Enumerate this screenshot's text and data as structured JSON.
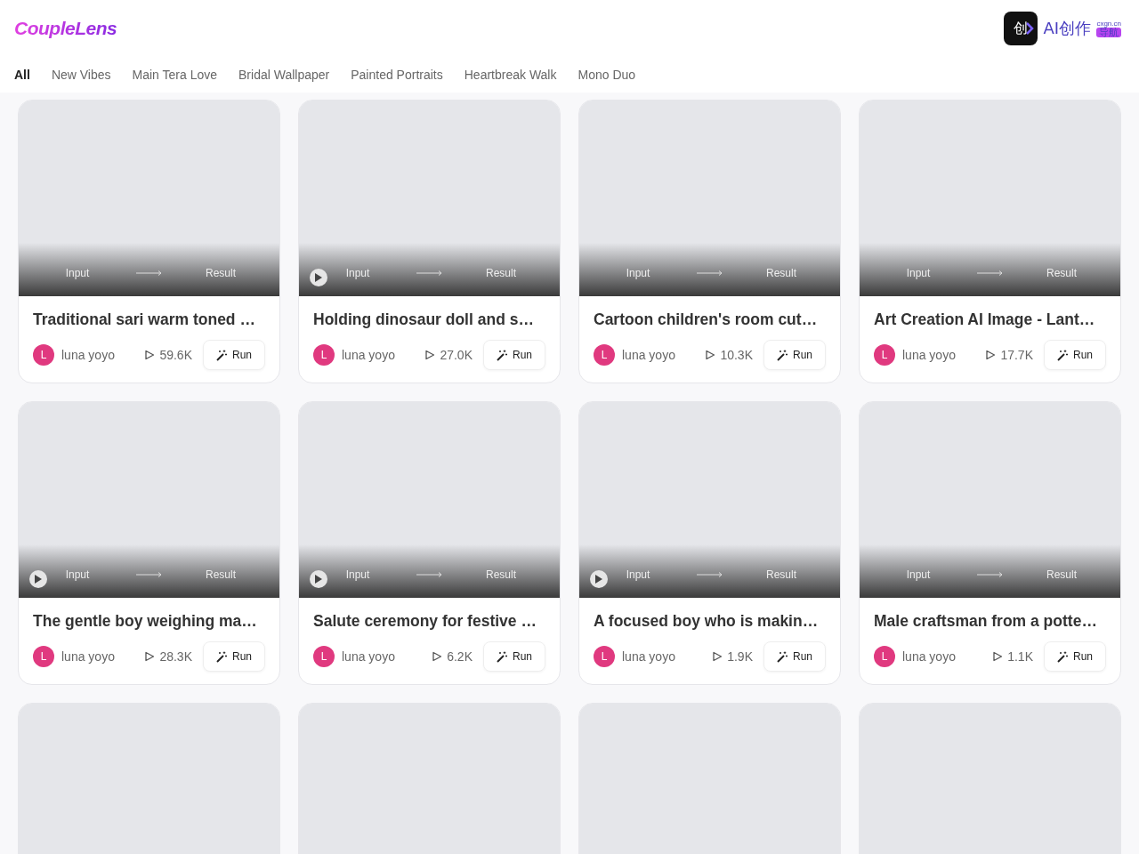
{
  "brand": "CoupleLens",
  "partner": {
    "icon_char": "创",
    "name": "AI创作",
    "domain": "cxgn.cn",
    "badge": "导航"
  },
  "tabs": [
    {
      "label": "All",
      "selected": true
    },
    {
      "label": "New Vibes",
      "selected": false
    },
    {
      "label": "Main Tera Love",
      "selected": false
    },
    {
      "label": "Bridal Wallpaper",
      "selected": false
    },
    {
      "label": "Painted Portraits",
      "selected": false
    },
    {
      "label": "Heartbreak Walk",
      "selected": false
    },
    {
      "label": "Mono Duo",
      "selected": false
    }
  ],
  "cards": [
    {
      "kind": "full",
      "has_play": false,
      "input": "Input",
      "result": "Result",
      "title": "Traditional sari warm toned …",
      "avatar": "L",
      "author": "luna yoyo",
      "plays": "59.6K",
      "action": "Run"
    },
    {
      "kind": "full",
      "has_play": true,
      "input": "Input",
      "result": "Result",
      "title": "Holding dinosaur doll and s…",
      "avatar": "L",
      "author": "luna yoyo",
      "plays": "27.0K",
      "action": "Run"
    },
    {
      "kind": "full",
      "has_play": false,
      "input": "Input",
      "result": "Result",
      "title": "Cartoon children's room cut…",
      "avatar": "L",
      "author": "luna yoyo",
      "plays": "10.3K",
      "action": "Run"
    },
    {
      "kind": "full",
      "has_play": false,
      "input": "Input",
      "result": "Result",
      "title": "Art Creation AI Image - Lant…",
      "avatar": "L",
      "author": "luna yoyo",
      "plays": "17.7K",
      "action": "Run"
    },
    {
      "kind": "full",
      "has_play": true,
      "input": "Input",
      "result": "Result",
      "title": "The gentle boy weighing ma…",
      "avatar": "L",
      "author": "luna yoyo",
      "plays": "28.3K",
      "action": "Run"
    },
    {
      "kind": "full",
      "has_play": true,
      "input": "Input",
      "result": "Result",
      "title": "Salute ceremony for festive …",
      "avatar": "L",
      "author": "luna yoyo",
      "plays": "6.2K",
      "action": "Run"
    },
    {
      "kind": "full",
      "has_play": true,
      "input": "Input",
      "result": "Result",
      "title": "A focused boy who is makin…",
      "avatar": "L",
      "author": "luna yoyo",
      "plays": "1.9K",
      "action": "Run"
    },
    {
      "kind": "full",
      "has_play": false,
      "input": "Input",
      "result": "Result",
      "title": "Male craftsman from a potte…",
      "avatar": "L",
      "author": "luna yoyo",
      "plays": "1.1K",
      "action": "Run"
    },
    {
      "kind": "partial"
    },
    {
      "kind": "partial"
    },
    {
      "kind": "partial"
    },
    {
      "kind": "partial"
    }
  ]
}
